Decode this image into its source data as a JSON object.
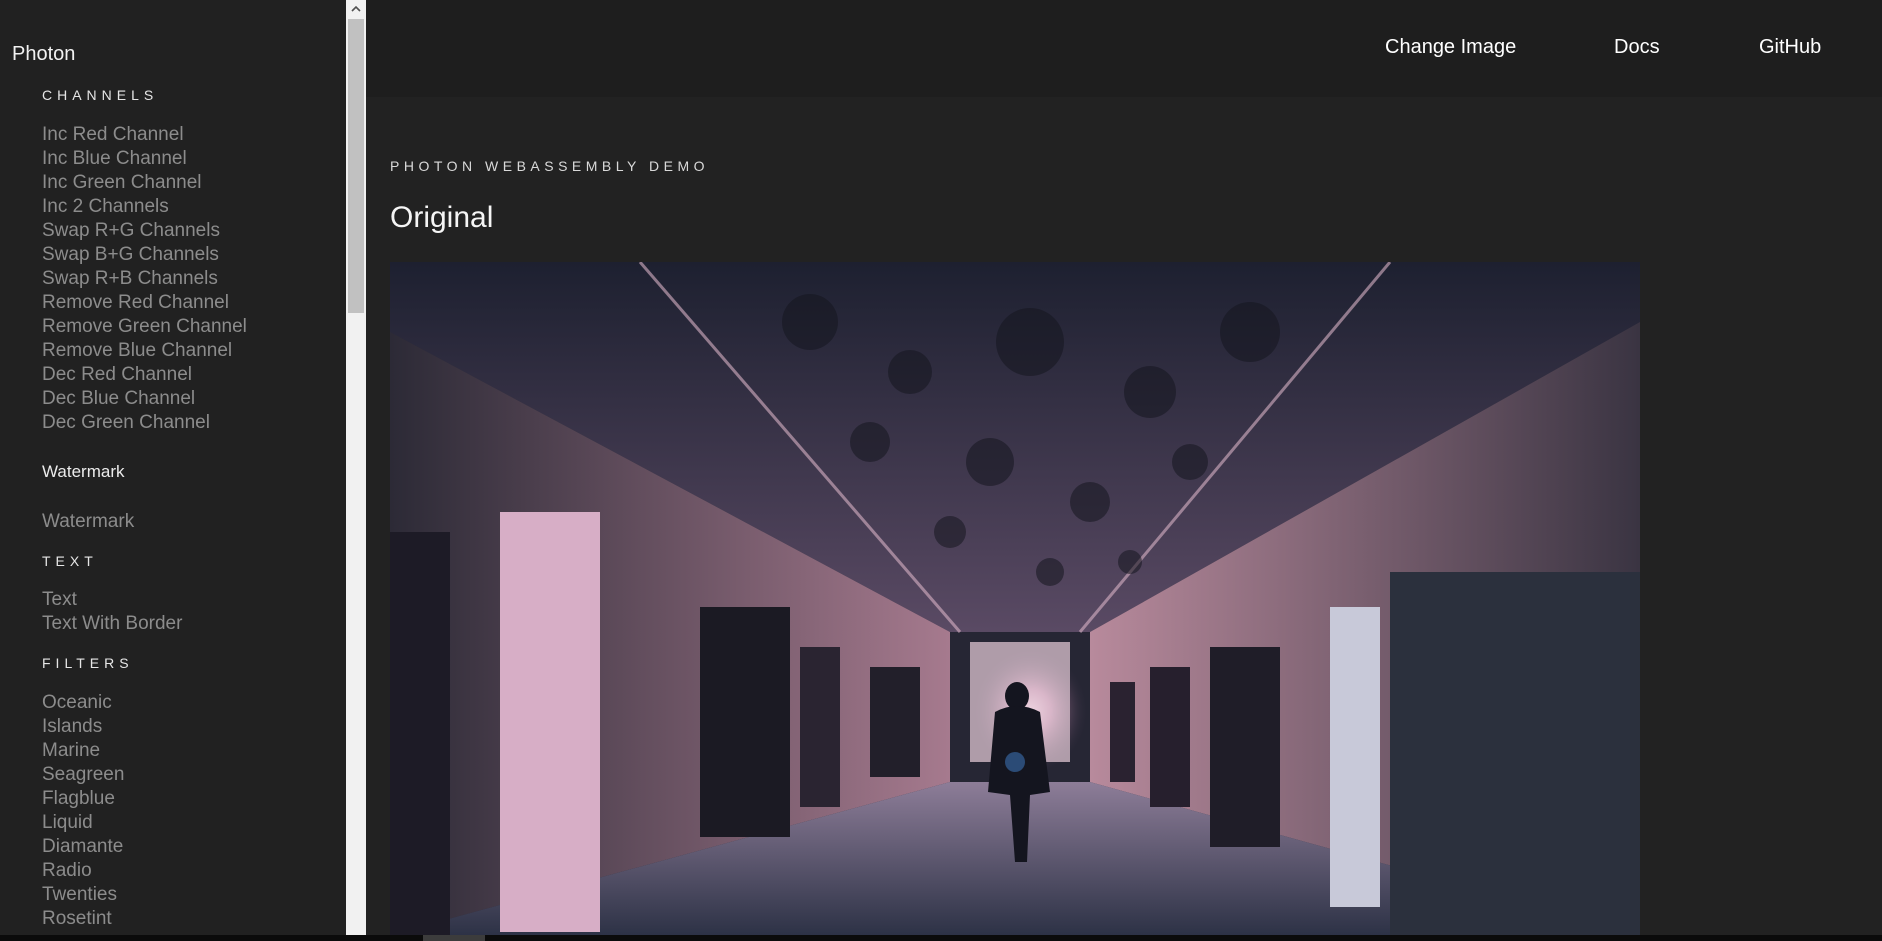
{
  "sidebar": {
    "brand": "Photon",
    "channels_heading": "CHANNELS",
    "channels": [
      "Inc Red Channel",
      "Inc Blue Channel",
      "Inc Green Channel",
      "Inc 2 Channels",
      "Swap R+G Channels",
      "Swap B+G Channels",
      "Swap R+B Channels",
      "Remove Red Channel",
      "Remove Green Channel",
      "Remove Blue Channel",
      "Dec Red Channel",
      "Dec Blue Channel",
      "Dec Green Channel"
    ],
    "watermark_heading": "Watermark",
    "watermark_items": [
      "Watermark"
    ],
    "text_heading": "TEXT",
    "text_items": [
      "Text",
      "Text With Border"
    ],
    "filters_heading": "FILTERS",
    "filters": [
      "Oceanic",
      "Islands",
      "Marine",
      "Seagreen",
      "Flagblue",
      "Liquid",
      "Diamante",
      "Radio",
      "Twenties",
      "Rosetint"
    ]
  },
  "nav": {
    "change_image": "Change Image",
    "docs": "Docs",
    "github": "GitHub"
  },
  "main": {
    "eyebrow": "PHOTON WEBASSEMBLY DEMO",
    "title": "Original"
  },
  "colors": {
    "background": "#212121",
    "menu_text": "#8c8c8c",
    "heading_text": "#e6e6e6"
  }
}
